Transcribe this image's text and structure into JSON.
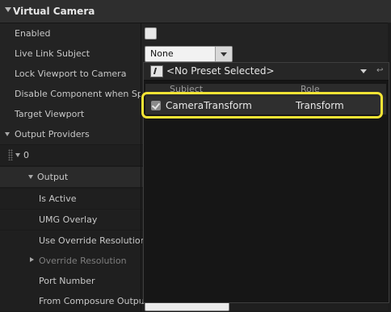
{
  "category": {
    "title": "Virtual Camera"
  },
  "properties": [
    {
      "label": "Enabled"
    },
    {
      "label": "Live Link Subject"
    },
    {
      "label": "Lock Viewport to Camera"
    },
    {
      "label": "Disable Component when Spawned"
    },
    {
      "label": "Target Viewport"
    },
    {
      "label": "Output Providers"
    },
    {
      "label": "0"
    },
    {
      "label": "Output"
    },
    {
      "label": "Is Active"
    },
    {
      "label": "UMG Overlay"
    },
    {
      "label": "Use Override Resolution"
    },
    {
      "label": "Override Resolution"
    },
    {
      "label": "Port Number"
    },
    {
      "label": "From Composure Output"
    }
  ],
  "enabled": {
    "checked": false
  },
  "live_link_combo": {
    "value": "None"
  },
  "dropdown": {
    "preset": "<No Preset Selected>",
    "preset_reset_icon": "return-icon",
    "columns": {
      "subject": "Subject",
      "role": "Role"
    },
    "rows": [
      {
        "subject": "CameraTransform",
        "role": "Transform",
        "checked": true
      }
    ]
  },
  "colors": {
    "highlight": "#f4e435",
    "panel_bg": "#1b1b1b",
    "popup_bg": "#161616"
  }
}
